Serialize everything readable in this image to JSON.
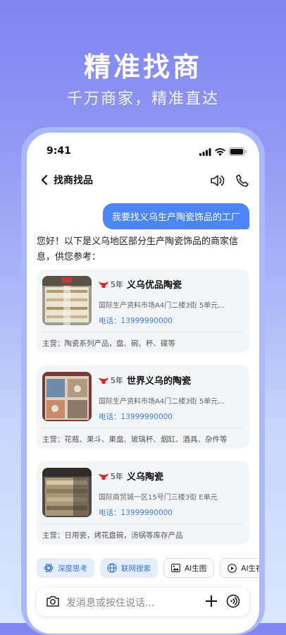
{
  "hero": {
    "title": "精准找商",
    "subtitle": "千万商家，精准直达"
  },
  "status": {
    "time": "9:41"
  },
  "nav": {
    "title": "找商找品"
  },
  "chat": {
    "user_message": "我要找义乌生产陶瓷饰品的工厂",
    "reply": "您好！以下是义乌地区部分生产陶瓷饰品的商家信息，供您参考："
  },
  "cards": [
    {
      "years": "5年",
      "name": "义乌优品陶瓷",
      "address": "国际生产资料市场A4门二楼3街 5单元...",
      "phone": "电话：13999990000",
      "main": "主营：陶瓷系列产品，盘、碗、杯、碟等"
    },
    {
      "years": "5年",
      "name": "世界义乌的陶瓷",
      "address": "国际生产资料市场A4门二楼3街 5单元...",
      "phone": "电话：13999990000",
      "main": "主营：花瓶、果斗、果盘、玻璃杯、烟缸、酒具、杂件等"
    },
    {
      "years": "5年",
      "name": "义乌陶瓷",
      "address": "国际商贸城一区15号门三楼3街 E单元",
      "phone": "电话：13999990000",
      "main": "主营：日用瓷，烤花盘碗，汤锅等库存产品"
    }
  ],
  "chips": {
    "deep": "深度思考",
    "web": "联网搜索",
    "image": "AI生图",
    "video": "AI生视频"
  },
  "input": {
    "placeholder": "发消息或按住说话..."
  },
  "colors": {
    "accent": "#4b86f6",
    "badge": "#e0262d"
  }
}
